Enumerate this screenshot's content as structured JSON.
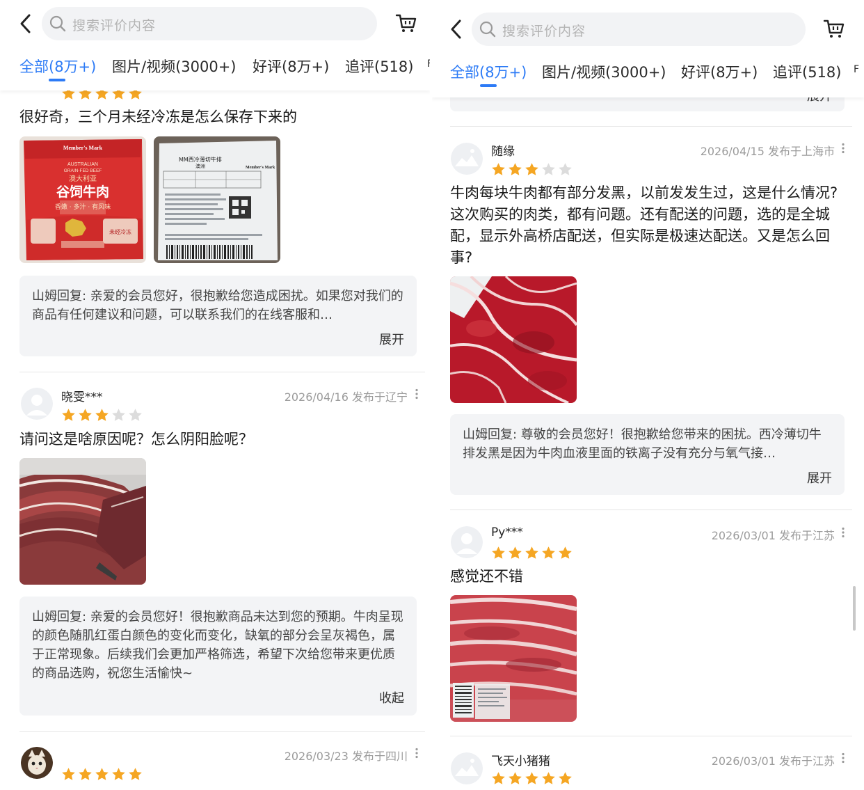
{
  "left": {
    "search": {
      "placeholder": "搜索评价内容"
    },
    "tabs": [
      {
        "label": "全部(8万+)"
      },
      {
        "label": "图片/视频(3000+)"
      },
      {
        "label": "好评(8万+)"
      },
      {
        "label": "追评(518)"
      },
      {
        "label": "F"
      }
    ],
    "reviews": [
      {
        "rating": 5,
        "text": "很好奇，三个月未经冷冻是怎么保存下来的",
        "photos": [
          {
            "kind": "package-red",
            "lines": [
              "Member's Mark",
              "AUSTRALIAN",
              "GRAIN-FED BEEF",
              "澳大利亚",
              "谷饲牛肉",
              "香嫩 · 多汁 · 有风味",
              "未经冷冻"
            ]
          },
          {
            "kind": "label-white",
            "lines": [
              "MM西冷薄切牛排",
              "澳洲",
              "Member's Mark"
            ]
          }
        ],
        "reply": {
          "text": "山姆回复: 亲爱的会员您好，很抱歉给您造成困扰。如果您对我们的商品有任何建议和问题，可以联系我们的在线客服和…",
          "toggle": "展开"
        }
      },
      {
        "user": "晓雯***",
        "date": "2026/04/16 发布于辽宁",
        "rating": 3,
        "text": "请问这是啥原因呢？怎么阴阳脸呢？",
        "photos": [
          {
            "kind": "meat-dark"
          }
        ],
        "reply": {
          "text": "山姆回复: 亲爱的会员您好！很抱歉商品未达到您的预期。牛肉呈现的颜色随肌红蛋白颜色的变化而变化，缺氧的部分会呈灰褐色，属于正常现象。后续我们会更加严格筛选，希望下次给您带来更优质的商品选购，祝您生活愉快~",
          "toggle": "收起"
        }
      },
      {
        "user": "",
        "date": "2026/03/23 发布于四川",
        "rating": 5
      }
    ]
  },
  "right": {
    "search": {
      "placeholder": "搜索评价内容"
    },
    "tabs": [
      {
        "label": "全部(8万+)"
      },
      {
        "label": "图片/视频(3000+)"
      },
      {
        "label": "好评(8万+)"
      },
      {
        "label": "追评(518)"
      },
      {
        "label": "F"
      }
    ],
    "partial_reply_toggle": "展开",
    "reviews": [
      {
        "user": "随缘",
        "date": "2026/04/15 发布于上海市",
        "rating": 3,
        "text": "牛肉每块牛肉都有部分发黑，以前发发生过，这是什么情况?这次购买的肉类，都有问题。还有配送的问题，选的是全城配，显示外高桥店配送，但实际是极速达配送。又是怎么回事?",
        "photos": [
          {
            "kind": "meat-red"
          }
        ],
        "reply": {
          "text": "山姆回复: 尊敬的会员您好！很抱歉给您带来的困扰。西冷薄切牛排发黑是因为牛肉血液里面的铁离子没有充分与氧气接…",
          "toggle": "展开"
        }
      },
      {
        "user": "Py***",
        "date": "2026/03/01 发布于江苏",
        "rating": 5,
        "text": "感觉还不错",
        "photos": [
          {
            "kind": "meat-pack"
          }
        ]
      },
      {
        "user": "飞天小猪猪",
        "date": "2026/03/01 发布于江苏",
        "rating": 5
      }
    ]
  },
  "colors": {
    "accent": "#2d7bf6",
    "star": "#f5a623",
    "star_empty": "#dcdcdc",
    "reply_bg": "#f3f4f6"
  },
  "icons": [
    "back-icon",
    "search-icon",
    "cart-icon",
    "more-icon",
    "star-icon",
    "avatar-placeholder-icon"
  ]
}
